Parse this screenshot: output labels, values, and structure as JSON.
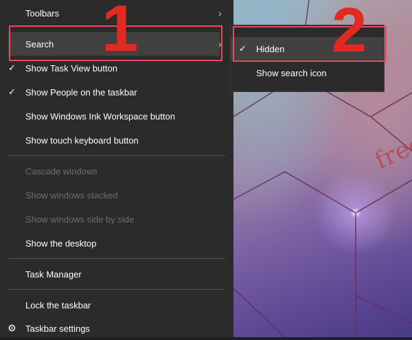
{
  "menu": {
    "items": [
      {
        "label": "Toolbars",
        "checked": false,
        "has_submenu": true,
        "disabled": false
      },
      {
        "label": "Search",
        "checked": false,
        "has_submenu": true,
        "disabled": false,
        "highlighted": true
      },
      {
        "label": "Show Task View button",
        "checked": true,
        "disabled": false
      },
      {
        "label": "Show People on the taskbar",
        "checked": true,
        "disabled": false
      },
      {
        "label": "Show Windows Ink Workspace button",
        "checked": false,
        "disabled": false
      },
      {
        "label": "Show touch keyboard button",
        "checked": false,
        "disabled": false
      },
      {
        "label": "Cascade windows",
        "disabled": true
      },
      {
        "label": "Show windows stacked",
        "disabled": true
      },
      {
        "label": "Show windows side by side",
        "disabled": true
      },
      {
        "label": "Show the desktop",
        "disabled": false
      },
      {
        "label": "Task Manager",
        "disabled": false
      },
      {
        "label": "Lock the taskbar",
        "checked": false,
        "disabled": false
      },
      {
        "label": "Taskbar settings",
        "icon": "gear-icon",
        "disabled": false
      }
    ]
  },
  "submenu": {
    "items": [
      {
        "label": "Hidden",
        "checked": true,
        "highlighted": true
      },
      {
        "label": "Show search icon",
        "checked": false
      }
    ]
  },
  "annotations": {
    "step1": "1",
    "step2": "2",
    "color": "#e12a22"
  },
  "watermark": "freetuts.net",
  "colors": {
    "menu_bg": "#2b2b2b",
    "highlight_bg": "#414141",
    "disabled_text": "#6d6d6d",
    "annotation_box": "#e84a5f"
  }
}
